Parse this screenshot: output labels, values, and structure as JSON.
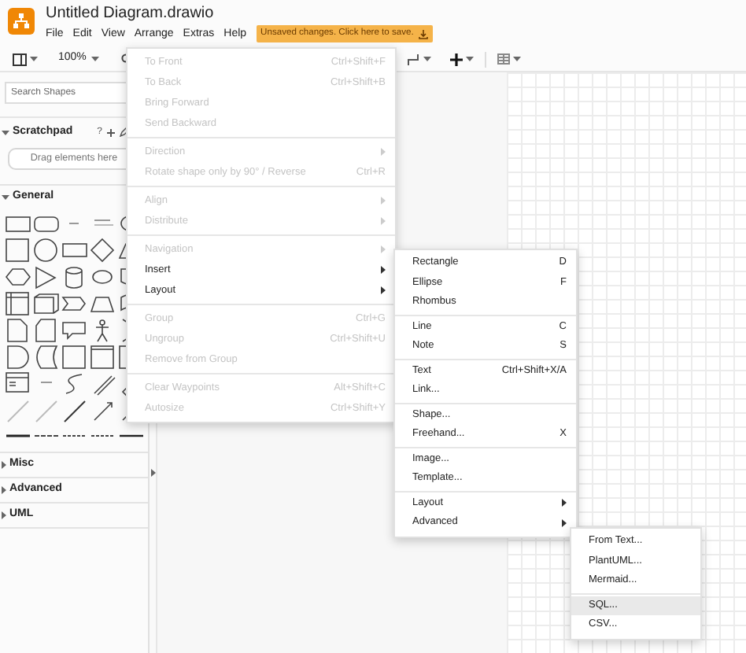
{
  "window": {
    "title": "Untitled Diagram.drawio"
  },
  "menubar": [
    "File",
    "Edit",
    "View",
    "Arrange",
    "Extras",
    "Help"
  ],
  "save_notice": "Unsaved changes. Click here to save.",
  "toolbar": {
    "zoom": "100%"
  },
  "sidebar": {
    "search": {
      "placeholder": "Search Shapes"
    },
    "scratchpad": {
      "title": "Scratchpad",
      "help": "?",
      "expanded": true,
      "drop_hint": "Drag elements here"
    },
    "sections": [
      {
        "title": "General",
        "expanded": true
      },
      {
        "title": "Misc",
        "expanded": false
      },
      {
        "title": "Advanced",
        "expanded": false
      },
      {
        "title": "UML",
        "expanded": false
      }
    ]
  },
  "arrange_menu": [
    [
      {
        "label": "To Front",
        "shortcut": "Ctrl+Shift+F",
        "disabled": true,
        "submenu": false
      },
      {
        "label": "To Back",
        "shortcut": "Ctrl+Shift+B",
        "disabled": true,
        "submenu": false
      },
      {
        "label": "Bring Forward",
        "disabled": true,
        "submenu": false
      },
      {
        "label": "Send Backward",
        "disabled": true,
        "submenu": false
      }
    ],
    [
      {
        "label": "Direction",
        "disabled": true,
        "submenu": true
      },
      {
        "label": "Rotate shape only by 90° / Reverse",
        "shortcut": "Ctrl+R",
        "disabled": true,
        "submenu": false
      }
    ],
    [
      {
        "label": "Align",
        "disabled": true,
        "submenu": true
      },
      {
        "label": "Distribute",
        "disabled": true,
        "submenu": true
      }
    ],
    [
      {
        "label": "Navigation",
        "disabled": true,
        "submenu": true
      },
      {
        "label": "Insert",
        "disabled": false,
        "submenu": true
      },
      {
        "label": "Layout",
        "disabled": false,
        "submenu": true
      }
    ],
    [
      {
        "label": "Group",
        "shortcut": "Ctrl+G",
        "disabled": true,
        "submenu": false
      },
      {
        "label": "Ungroup",
        "shortcut": "Ctrl+Shift+U",
        "disabled": true,
        "submenu": false
      },
      {
        "label": "Remove from Group",
        "disabled": true,
        "submenu": false
      }
    ],
    [
      {
        "label": "Clear Waypoints",
        "shortcut": "Alt+Shift+C",
        "disabled": true,
        "submenu": false
      },
      {
        "label": "Autosize",
        "shortcut": "Ctrl+Shift+Y",
        "disabled": true,
        "submenu": false
      }
    ]
  ],
  "insert_menu": [
    [
      {
        "label": "Rectangle",
        "shortcut": "D",
        "submenu": false
      },
      {
        "label": "Ellipse",
        "shortcut": "F",
        "submenu": false
      },
      {
        "label": "Rhombus",
        "submenu": false
      }
    ],
    [
      {
        "label": "Line",
        "shortcut": "C",
        "submenu": false
      },
      {
        "label": "Note",
        "shortcut": "S",
        "submenu": false
      }
    ],
    [
      {
        "label": "Text",
        "shortcut": "Ctrl+Shift+X/A",
        "submenu": false
      },
      {
        "label": "Link...",
        "submenu": false
      }
    ],
    [
      {
        "label": "Shape...",
        "submenu": false
      },
      {
        "label": "Freehand...",
        "shortcut": "X",
        "submenu": false
      }
    ],
    [
      {
        "label": "Image...",
        "submenu": false
      },
      {
        "label": "Template...",
        "submenu": false
      }
    ],
    [
      {
        "label": "Layout",
        "submenu": true
      },
      {
        "label": "Advanced",
        "submenu": true
      }
    ]
  ],
  "advanced_menu": [
    [
      {
        "label": "From Text...",
        "selected": false
      },
      {
        "label": "PlantUML...",
        "selected": false
      },
      {
        "label": "Mermaid...",
        "selected": false
      }
    ],
    [
      {
        "label": "SQL...",
        "selected": true
      },
      {
        "label": "CSV...",
        "selected": false
      }
    ]
  ]
}
